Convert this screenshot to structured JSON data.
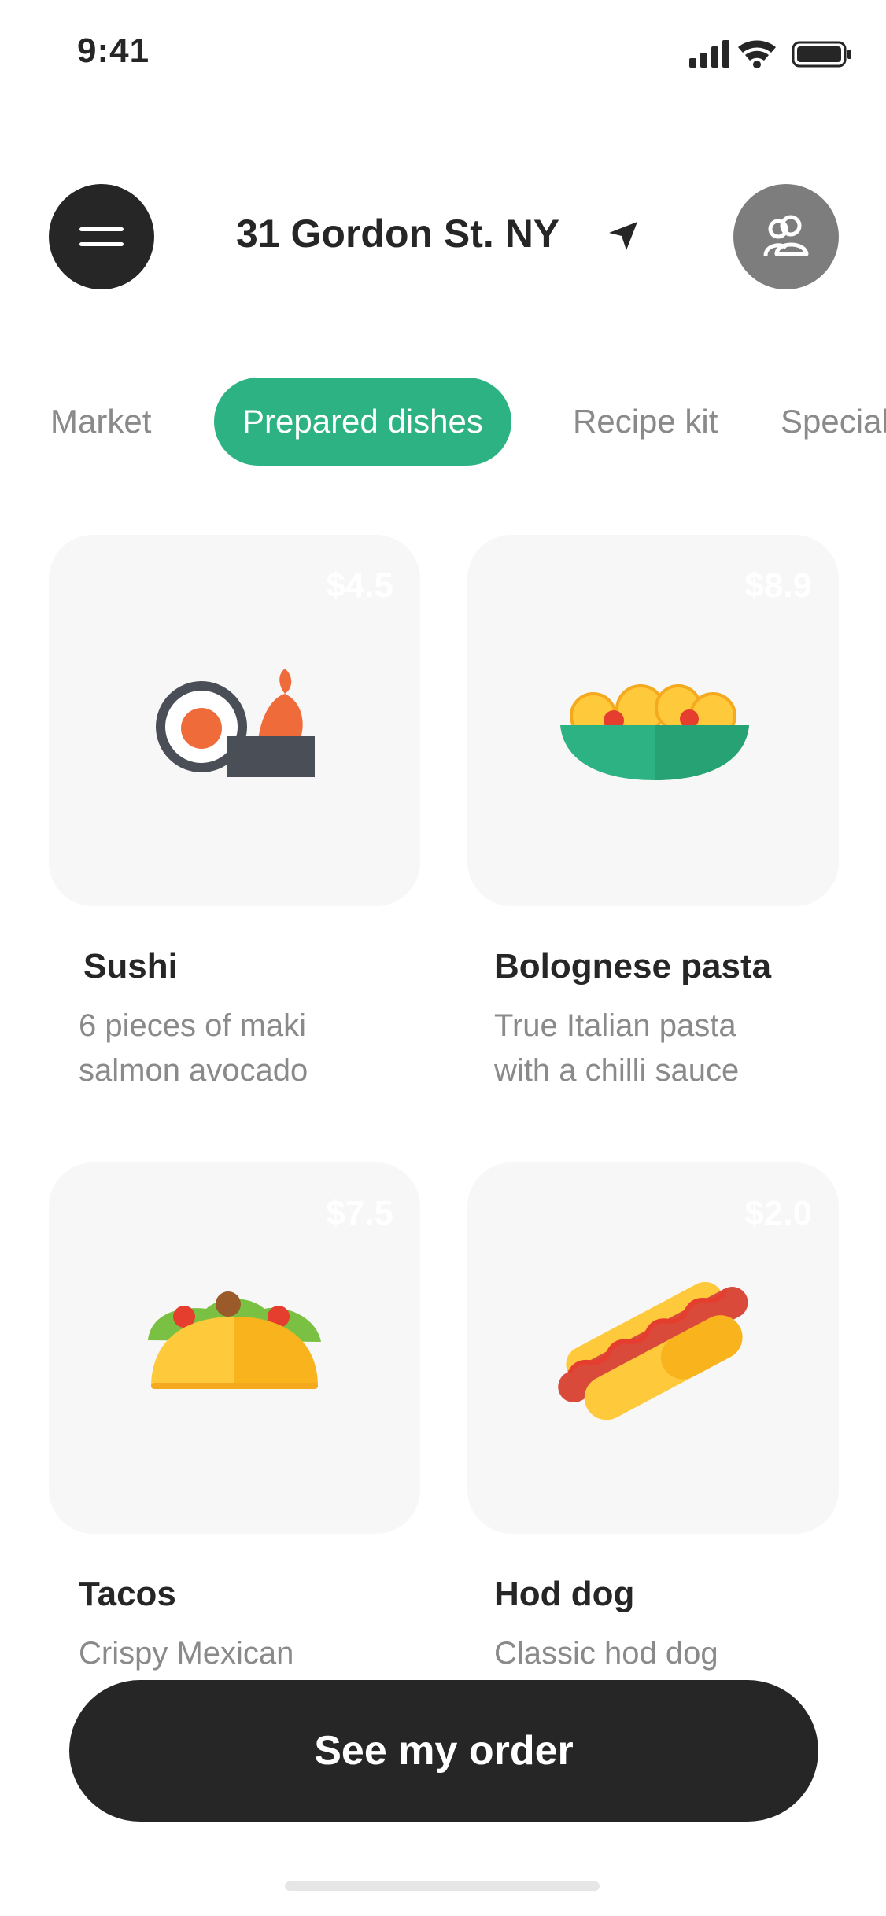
{
  "status_bar": {
    "time": "9:41"
  },
  "header": {
    "address": "31 Gordon St. NY"
  },
  "tabs": [
    {
      "label": "Market",
      "active": false
    },
    {
      "label": "Prepared dishes",
      "active": true
    },
    {
      "label": "Recipe kit",
      "active": false
    },
    {
      "label": "Specials",
      "active": false
    }
  ],
  "products": [
    {
      "name": "Sushi",
      "price": "$4.5",
      "desc_line1": "6 pieces of maki",
      "desc_line2": "salmon avocado",
      "icon": "sushi-icon"
    },
    {
      "name": "Bolognese pasta",
      "price": "$8.9",
      "desc_line1": "True Italian pasta",
      "desc_line2": "with a chilli sauce",
      "icon": "pasta-icon"
    },
    {
      "name": "Tacos",
      "price": "$7.5",
      "desc_line1": "Crispy Mexican",
      "desc_line2": "",
      "icon": "taco-icon"
    },
    {
      "name": "Hod dog",
      "price": "$2.0",
      "desc_line1": "Classic hod dog",
      "desc_line2": "",
      "icon": "hotdog-icon"
    }
  ],
  "cta": {
    "label": "See my order"
  },
  "colors": {
    "accent": "#2db383",
    "dark": "#262626",
    "muted": "#8a8a8a",
    "card_bg": "#f7f7f7"
  }
}
